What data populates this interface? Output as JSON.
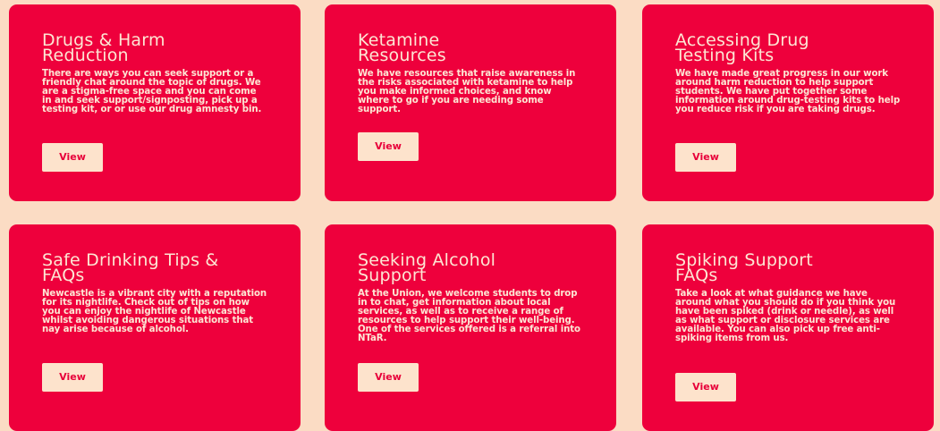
{
  "cards": [
    {
      "title": "Drugs & Harm Reduction",
      "description": "There are ways you can seek support or a friendly chat around the topic of drugs. We are a stigma-free space and you can come in and seek support/signposting, pick up a testing kit, or or use our drug amnesty bin.",
      "button": "View"
    },
    {
      "title": "Ketamine Resources",
      "description": "We have resources that raise awareness in the risks associated with ketamine to help you make informed choices, and know where to go if you are needing some support.",
      "button": "View"
    },
    {
      "title": "Accessing Drug Testing Kits",
      "description": "We have made great progress in our work around harm reduction to help support students. We have put together some information around drug-testing kits to help you reduce risk if you are taking drugs.",
      "button": "View"
    },
    {
      "title": "Safe Drinking Tips & FAQs",
      "description": "Newcastle is a vibrant city with a reputation for its nightlife. Check out of tips on how you can enjoy the nightlife of Newcastle whilst avoiding dangerous situations that nay arise because of alcohol.",
      "button": "View"
    },
    {
      "title": "Seeking Alcohol Support",
      "description": "At the Union, we welcome students to drop in to chat, get information about local services, as well as to receive a range of resources to help support their well-being. One of the services offered is a referral into NTaR.",
      "button": "View"
    },
    {
      "title": "Spiking Support FAQs",
      "description": "Take a look at what guidance we have around what you should do if you think you have been spiked (drink or needle), as well as what support or disclosure services are available. You can also pick up free anti-spiking items from us.",
      "button": "View"
    }
  ]
}
